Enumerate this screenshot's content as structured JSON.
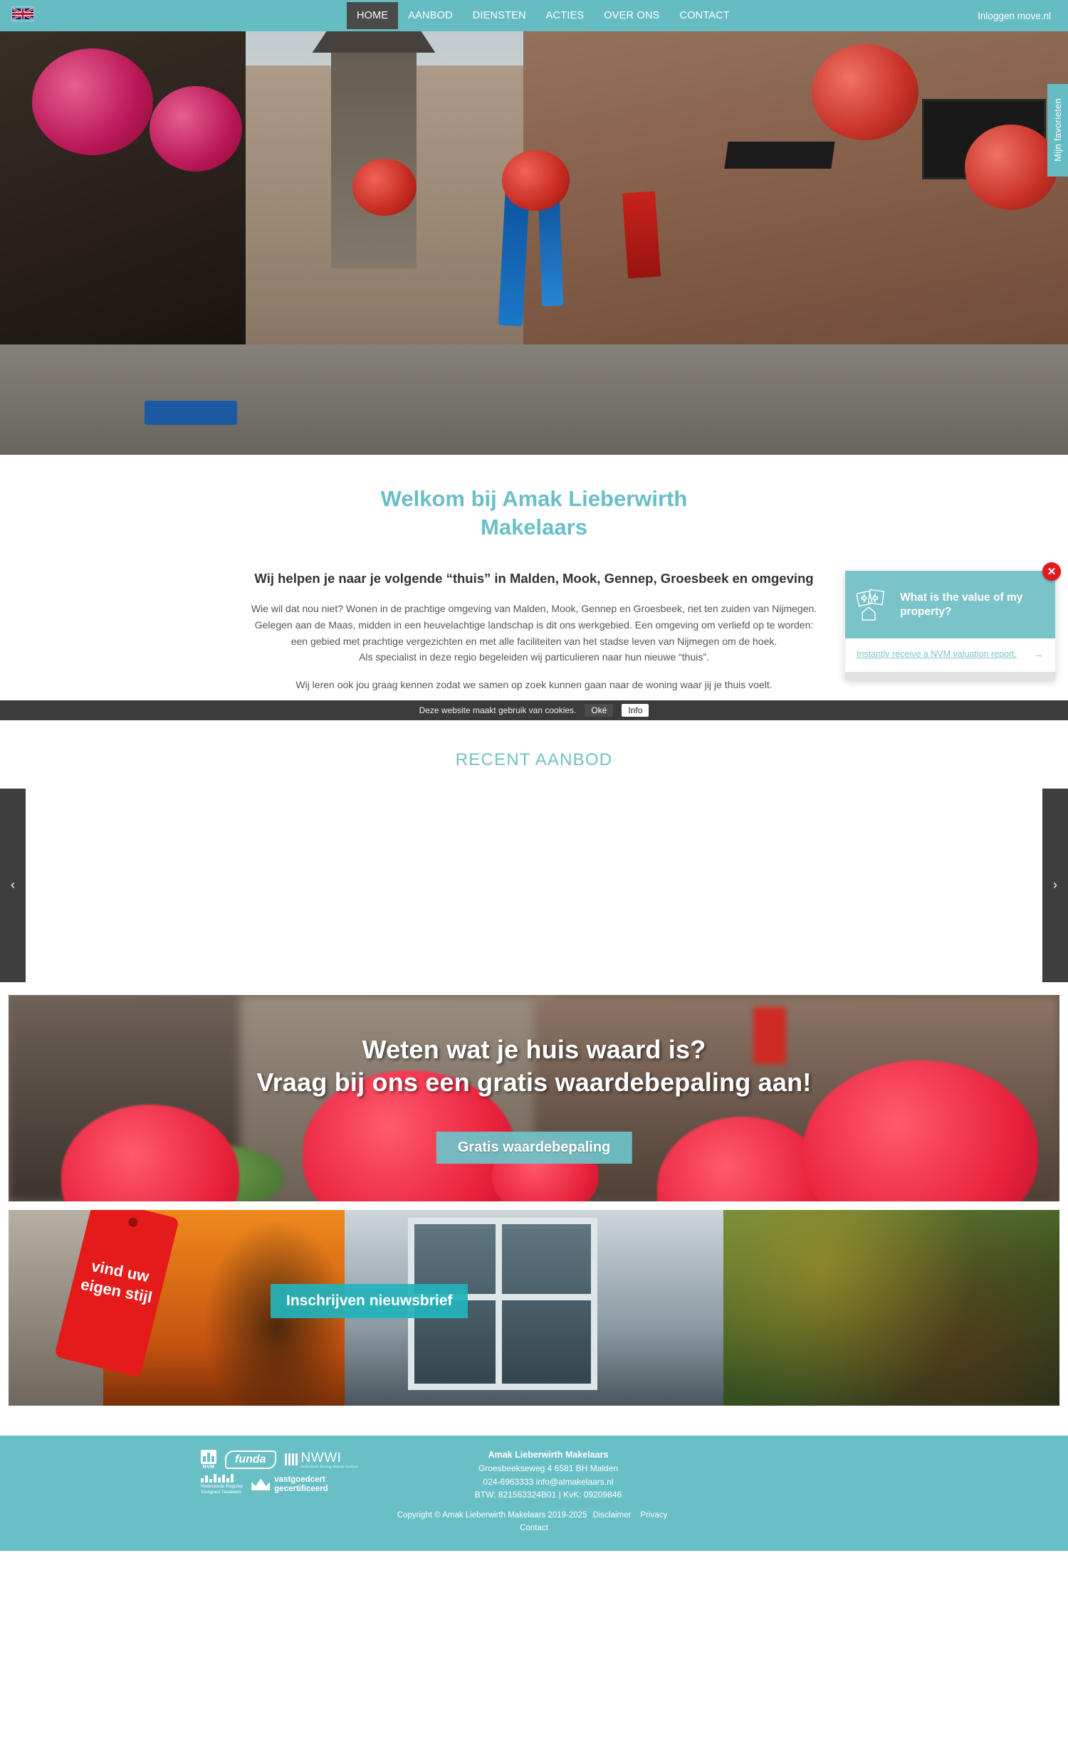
{
  "nav": {
    "flag_icon": "uk-flag-icon",
    "items": [
      {
        "label": "HOME",
        "active": true
      },
      {
        "label": "AANBOD",
        "active": false
      },
      {
        "label": "DIENSTEN",
        "active": false
      },
      {
        "label": "ACTIES",
        "active": false
      },
      {
        "label": "OVER ONS",
        "active": false
      },
      {
        "label": "CONTACT",
        "active": false
      }
    ],
    "login_label": "Inloggen move.nl"
  },
  "hero": {
    "favorites_tab": "Mijn favorieten"
  },
  "welcome": {
    "heading": "Welkom bij Amak Lieberwirth Makelaars",
    "subheading": "Wij helpen je naar je volgende “thuis” in Malden, Mook, Gennep, Groesbeek en omgeving",
    "paragraph_lines": [
      "Wie wil dat nou niet? Wonen in de prachtige omgeving van Malden, Mook, Gennep en Groesbeek, net ten zuiden van Nijmegen.",
      "Gelegen aan de Maas, midden in een heuvelachtige landschap is dit ons werkgebied. Een omgeving om verliefd op te worden:",
      "een gebied met prachtige vergezichten en met alle faciliteiten van het stadse leven van Nijmegen om de hoek.",
      "Als specialist in deze regio begeleiden wij particulieren naar hun nieuwe “thuis”."
    ],
    "paragraph_last": "Wij leren ook jou graag kennen zodat we samen op zoek kunnen gaan naar de woning waar jij je thuis voelt."
  },
  "popup": {
    "title": "What is the value of my property?",
    "link": "Instantly receive a NVM valuation report.",
    "arrow_icon": "arrow-right-icon",
    "close_icon": "close-icon",
    "icon": "house-valuation-icon"
  },
  "cookiebar": {
    "message": "Deze website maakt gebruik van cookies.",
    "ok_label": "Oké",
    "info_label": "Info"
  },
  "recent": {
    "heading": "RECENT AANBOD",
    "prev_icon": "chevron-left-icon",
    "next_icon": "chevron-right-icon"
  },
  "valuation_banner": {
    "line1": "Weten wat je huis waard is?",
    "line2": "Vraag bij ons een gratis waardebepaling aan!",
    "button_label": "Gratis waardebepaling"
  },
  "newsletter_banner": {
    "tag_line1": "vind uw",
    "tag_line2": "eigen stijl",
    "button_label": "Inschrijven nieuwsbrief"
  },
  "footer": {
    "logos": {
      "nvm": "NVM",
      "funda": "funda",
      "nwwi": "NWWI",
      "nwwi_sub": "Nederlands Woning Waarde Instituut",
      "nrvt_line1": "Nederlands Register",
      "nrvt_line2": "Vastgoed Taxateurs",
      "vastgoedcert_line1": "vastgoedcert",
      "vastgoedcert_line2": "gecertificeerd"
    },
    "company": "Amak Lieberwirth Makelaars",
    "address": "Groesbeekseweg 4   6581 BH Malden",
    "contact": "024-6963333   info@almakelaars.nl",
    "registration": "BTW: 821563324B01  |  KvK: 09209846",
    "copyright": "Copyright © Amak Lieberwirth Makelaars 2019-2025",
    "links": [
      "Disclaimer",
      "Privacy",
      "Contact"
    ]
  },
  "colors": {
    "teal": "#66bcc3",
    "teal_light": "#79c3c9",
    "dark": "#3b3b3b",
    "red": "#e01b22",
    "nav_active": "#4a4a4a"
  }
}
